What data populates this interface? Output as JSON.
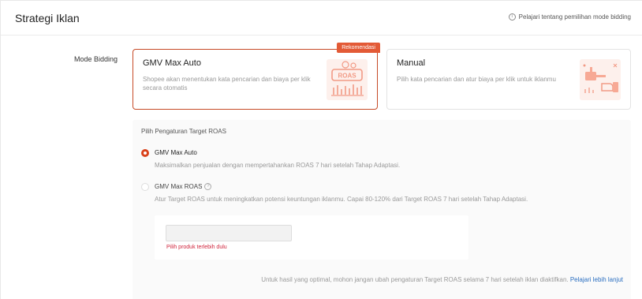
{
  "header": {
    "title": "Strategi Iklan",
    "learn_link": "Pelajari tentang pemilihan mode bidding"
  },
  "mode_bidding": {
    "label": "Mode Bidding",
    "options": [
      {
        "title": "GMV Max Auto",
        "description": "Shopee akan menentukan kata pencarian dan biaya per klik secara otomatis",
        "badge": "Rekomendasi",
        "selected": true,
        "illustration_icon": "roas-illustration-icon"
      },
      {
        "title": "Manual",
        "description": "Pilih kata pencarian dan atur biaya per klik untuk iklanmu",
        "selected": false,
        "illustration_icon": "auction-hammer-illustration-icon"
      }
    ]
  },
  "roas_settings": {
    "heading": "Pilih Pengaturan Target ROAS",
    "options": [
      {
        "title": "GMV Max Auto",
        "description": "Maksimalkan penjualan dengan mempertahankan ROAS 7 hari setelah Tahap Adaptasi.",
        "selected": true
      },
      {
        "title": "GMV Max ROAS",
        "description": "Atur Target ROAS untuk meningkatkan potensi keuntungan iklanmu. Capai 80-120% dari Target ROAS 7 hari setelah Tahap Adaptasi.",
        "selected": false
      }
    ],
    "target_input": {
      "value": "",
      "placeholder": "",
      "error": "Pilih produk terlebih dulu"
    },
    "footnote": "Untuk hasil yang optimal, mohon jangan ubah pengaturan Target ROAS selama 7 hari setelah iklan diaktifkan.",
    "footnote_link": "Pelajari lebih lanjut"
  },
  "colors": {
    "accent": "#d9421b",
    "selected_border": "#c64a26",
    "badge": "#e35a36",
    "illustration": "#f7b3a3",
    "link": "#2a6ec0",
    "error": "#d0253c"
  }
}
